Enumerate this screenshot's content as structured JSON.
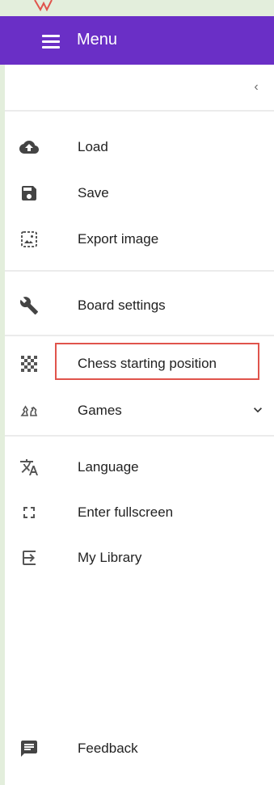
{
  "header": {
    "title": "Menu"
  },
  "panel": {
    "collapse_glyph": "‹"
  },
  "menu": {
    "load": "Load",
    "save": "Save",
    "export_image": "Export image",
    "board_settings": "Board settings",
    "chess_starting_position": "Chess starting position",
    "games": "Games",
    "language": "Language",
    "enter_fullscreen": "Enter fullscreen",
    "my_library": "My Library",
    "feedback": "Feedback"
  },
  "colors": {
    "header_bg": "#6a2fc6",
    "page_bg": "#e3eedc",
    "highlight": "#e0544c",
    "icon": "#444444"
  }
}
